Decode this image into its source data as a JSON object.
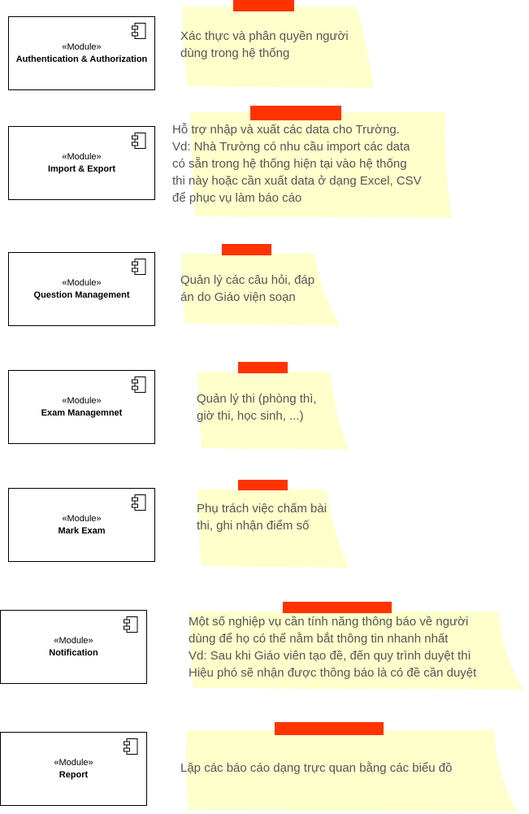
{
  "colors": {
    "note_fill": "#ffffcc",
    "tape": "#ff3300",
    "note_text": "#555555",
    "module_border": "#000000"
  },
  "modules": [
    {
      "stereotype": "«Module»",
      "name": "Authentication & Authorization",
      "icon": "component-icon"
    },
    {
      "stereotype": "«Module»",
      "name": "Import & Export",
      "icon": "component-icon"
    },
    {
      "stereotype": "«Module»",
      "name": "Question Management",
      "icon": "component-icon"
    },
    {
      "stereotype": "«Module»",
      "name": "Exam Managemnet",
      "icon": "component-icon"
    },
    {
      "stereotype": "«Module»",
      "name": "Mark Exam",
      "icon": "component-icon"
    },
    {
      "stereotype": "«Module»",
      "name": "Notification",
      "icon": "component-icon"
    },
    {
      "stereotype": "«Module»",
      "name": "Report",
      "icon": "component-icon"
    }
  ],
  "notes": [
    {
      "text": "Xác thực và phân quyền người\ndùng trong hệ thống"
    },
    {
      "text": "Hỗ trợ nhập và xuất các data cho Trường.\nVd: Nhà Trường có nhu cầu import các data\ncó sẵn trong hệ thống hiện tại vào hệ thống\nthi này hoặc cần xuất data ở dạng Excel, CSV\nđể phục vụ làm báo cáo"
    },
    {
      "text": "Quản lý các câu hỏi, đáp\nán do Giáo viện soạn"
    },
    {
      "text": "Quản lý thi (phòng thì,\ngiờ thi, học sinh, ...)"
    },
    {
      "text": "Phụ trách việc chấm bài\nthi, ghi nhận điểm số"
    },
    {
      "text": "Một số nghiệp vụ cần tính năng thông báo về người\ndùng để họ có thể nằm bắt thông tin nhanh nhất\nVd: Sau khi Giáo viên tạo đề, đến quy trình duyệt thì\nHiệu phó sẽ nhận được thông báo là có đề cần duyệt"
    },
    {
      "text": "Lập các báo cáo dạng trực quan bằng các biểu đồ"
    }
  ]
}
